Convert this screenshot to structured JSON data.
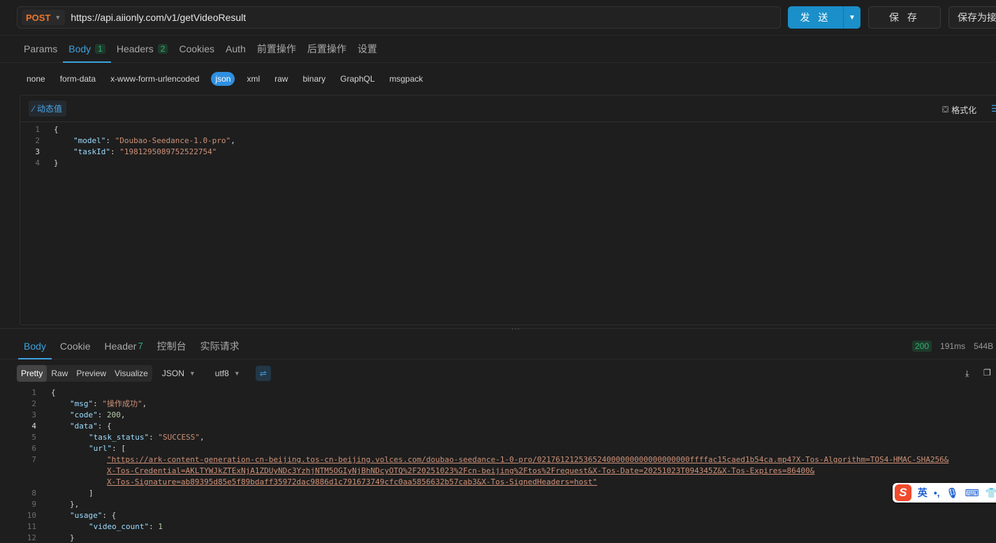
{
  "request": {
    "method": "POST",
    "url": "https://api.aiionly.com/v1/getVideoResult",
    "send_label": "发 送",
    "save_label": "保 存",
    "save_as_label": "保存为接口"
  },
  "request_tabs": [
    {
      "label": "Params"
    },
    {
      "label": "Body",
      "badge": "1"
    },
    {
      "label": "Headers",
      "badge": "2"
    },
    {
      "label": "Cookies"
    },
    {
      "label": "Auth"
    },
    {
      "label": "前置操作"
    },
    {
      "label": "后置操作"
    },
    {
      "label": "设置"
    }
  ],
  "body_types": [
    "none",
    "form-data",
    "x-www-form-urlencoded",
    "json",
    "xml",
    "raw",
    "binary",
    "GraphQL",
    "msgpack"
  ],
  "editor": {
    "dynamic_label": "动态值",
    "format_label": "格式化",
    "line_numbers": [
      "1",
      "2",
      "3",
      "4"
    ]
  },
  "request_body": {
    "model_key": "\"model\"",
    "model_value": "\"Doubao-Seedance-1.0-pro\"",
    "taskid_key": "\"taskId\"",
    "taskid_value": "\"1981295089752522754\""
  },
  "response_tabs": [
    {
      "label": "Body"
    },
    {
      "label": "Cookie"
    },
    {
      "label": "Header",
      "badge": "7"
    },
    {
      "label": "控制台"
    },
    {
      "label": "实际请求"
    }
  ],
  "response_meta": {
    "status": "200",
    "time": "191ms",
    "size": "544B"
  },
  "view_modes": [
    "Pretty",
    "Raw",
    "Preview",
    "Visualize"
  ],
  "format_select": "JSON",
  "encoding_select": "utf8",
  "response_line_numbers": [
    "1",
    "2",
    "3",
    "4",
    "5",
    "6",
    "7",
    "",
    "",
    "8",
    "9",
    "10",
    "11",
    "12"
  ],
  "response_body": {
    "msg_key": "\"msg\"",
    "msg_value": "\"操作成功\"",
    "code_key": "\"code\"",
    "code_value": "200",
    "data_key": "\"data\"",
    "task_status_key": "\"task_status\"",
    "task_status_value": "\"SUCCESS\"",
    "url_key": "\"url\"",
    "url_line1": "\"https://ark-content-generation-cn-beijing.tos-cn-beijing.volces.com/doubao-seedance-1-0-pro/021761212536524000000000000000000ffffac15caed1b54ca.mp4?X-Tos-Algorithm=TOS4-HMAC-SHA256&",
    "url_line2": "X-Tos-Credential=AKLTYWJkZTExNjA1ZDUyNDc3YzhjNTM5OGIyNjBhNDcyOTQ%2F20251023%2Fcn-beijing%2Ftos%2Frequest&X-Tos-Date=20251023T094345Z&X-Tos-Expires=86400&",
    "url_line3": "X-Tos-Signature=ab89395d85e5f89bdaff35972dac9886d1c791673749cfc0aa5856632b57cab3&X-Tos-SignedHeaders=host\"",
    "usage_key": "\"usage\"",
    "video_count_key": "\"video_count\"",
    "video_count_value": "1"
  },
  "ime": {
    "logo": "S",
    "mode": "英"
  }
}
